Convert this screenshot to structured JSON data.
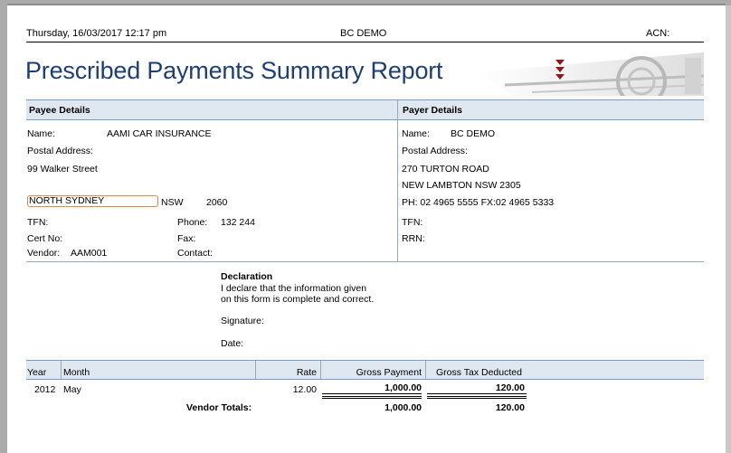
{
  "header": {
    "datetime": "Thursday, 16/03/2017 12:17 pm",
    "company": "BC DEMO",
    "acn_label": "ACN:"
  },
  "title": "Prescribed Payments Summary Report",
  "payee": {
    "section": "Payee Details",
    "name_label": "Name:",
    "name": "AAMI CAR INSURANCE",
    "postal_label": "Postal Address:",
    "street": "99 Walker Street",
    "suburb": "NORTH SYDNEY",
    "state": "NSW",
    "postcode": "2060",
    "tfn_label": "TFN:",
    "phone_label": "Phone:",
    "phone": "132 244",
    "cert_label": "Cert No:",
    "fax_label": "Fax:",
    "vendor_label": "Vendor:",
    "vendor": "AAM001",
    "contact_label": "Contact:"
  },
  "payer": {
    "section": "Payer Details",
    "name_label": "Name:",
    "name": "BC DEMO",
    "postal_label": "Postal Address:",
    "street": "270 TURTON ROAD",
    "suburb_line": "NEW LAMBTON NSW  2305",
    "phone_line": "PH: 02  4965 5555 FX:02 4965 5333",
    "tfn_label": "TFN:",
    "rrn_label": "RRN:"
  },
  "declaration": {
    "heading": "Declaration",
    "line1": "I declare that the information given",
    "line2": "on this form is complete and correct.",
    "signature_label": "Signature:",
    "date_label": "Date:"
  },
  "table": {
    "columns": [
      "Year",
      "Month",
      "Rate",
      "Gross Payment",
      "Gross Tax Deducted"
    ],
    "rows": [
      {
        "year": "2012",
        "month": "May",
        "rate": "12.00",
        "gross_payment": "1,000.00",
        "tax_deducted": "120.00"
      }
    ],
    "totals_label": "Vendor Totals:",
    "totals_payment": "1,000.00",
    "totals_tax": "120.00"
  }
}
